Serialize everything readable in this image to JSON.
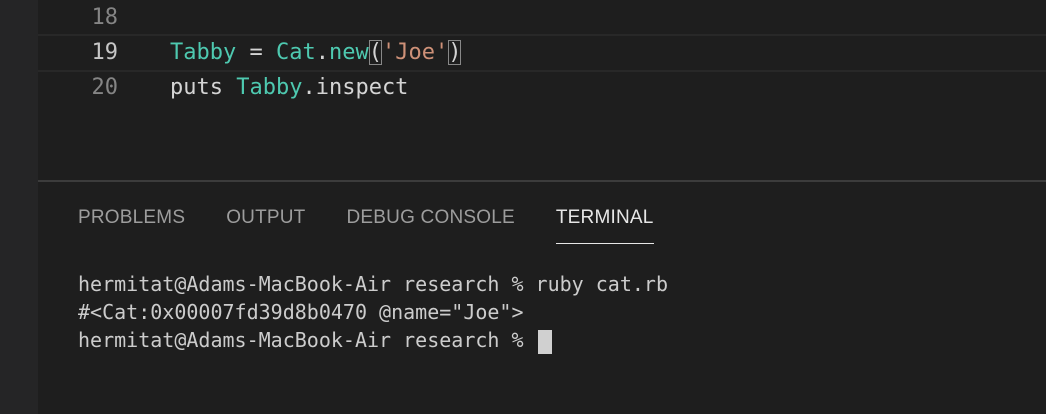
{
  "editor": {
    "lines": [
      {
        "number": "18",
        "tokens": []
      },
      {
        "number": "19",
        "tokens": [
          "Tabby",
          " = ",
          "Cat",
          ".",
          "new",
          "(",
          "'Joe'",
          ")"
        ]
      },
      {
        "number": "20",
        "tokens": [
          "puts ",
          "Tabby",
          ".inspect"
        ]
      }
    ]
  },
  "panel": {
    "tabs": [
      {
        "label": "PROBLEMS"
      },
      {
        "label": "OUTPUT"
      },
      {
        "label": "DEBUG CONSOLE"
      },
      {
        "label": "TERMINAL",
        "active": true
      }
    ]
  },
  "terminal": {
    "lines": [
      "hermitat@Adams-MacBook-Air research % ruby cat.rb",
      "#<Cat:0x00007fd39d8b0470 @name=\"Joe\">",
      "hermitat@Adams-MacBook-Air research % "
    ]
  },
  "colors": {
    "background": "#1e1e1e",
    "constant": "#4ec9b0",
    "string": "#ce9178",
    "text": "#d4d4d4",
    "line_number": "#858585"
  }
}
